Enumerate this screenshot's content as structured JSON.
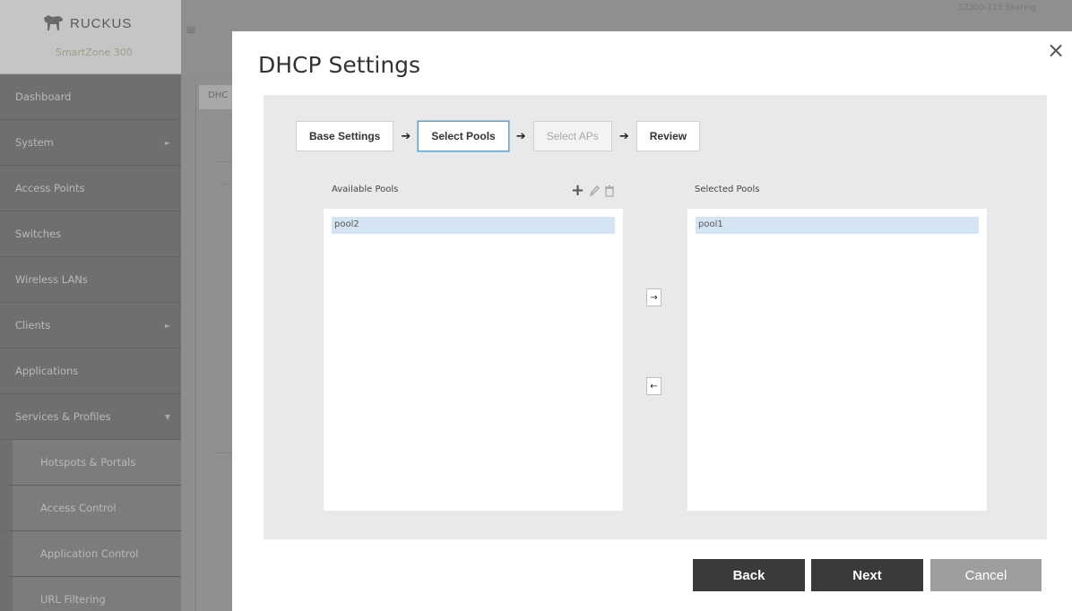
{
  "app": {
    "logo_text": "RUCKUS",
    "product": "SmartZone 300",
    "top_right": "SZ300-115 Sharing"
  },
  "sidebar": {
    "items": [
      {
        "label": "Dashboard"
      },
      {
        "label": "System",
        "arrow": "►"
      },
      {
        "label": "Access Points"
      },
      {
        "label": "Switches"
      },
      {
        "label": "Wireless LANs"
      },
      {
        "label": "Clients",
        "arrow": "►"
      },
      {
        "label": "Applications"
      },
      {
        "label": "Services & Profiles",
        "arrow": "▼"
      }
    ],
    "subitems": [
      {
        "label": "Hotspots & Portals"
      },
      {
        "label": "Access Control"
      },
      {
        "label": "Application Control"
      },
      {
        "label": "URL Filtering"
      }
    ]
  },
  "background": {
    "tab_label": "DHC"
  },
  "modal": {
    "title": "DHCP Settings",
    "close": "×",
    "steps": [
      {
        "label": "Base Settings",
        "state": "normal"
      },
      {
        "label": "Select Pools",
        "state": "active"
      },
      {
        "label": "Select APs",
        "state": "disabled"
      },
      {
        "label": "Review",
        "state": "normal"
      }
    ],
    "step_arrow": "➔",
    "available_label": "Available Pools",
    "selected_label": "Selected Pools",
    "available_pools": [
      "pool2"
    ],
    "selected_pools": [
      "pool1"
    ],
    "move_right": "→",
    "move_left": "←",
    "buttons": {
      "back": "Back",
      "next": "Next",
      "cancel": "Cancel"
    }
  },
  "colors": {
    "selection": "#d5e4f3",
    "primary_button": "#3a3a3a",
    "cancel_button": "#9e9e9e"
  }
}
